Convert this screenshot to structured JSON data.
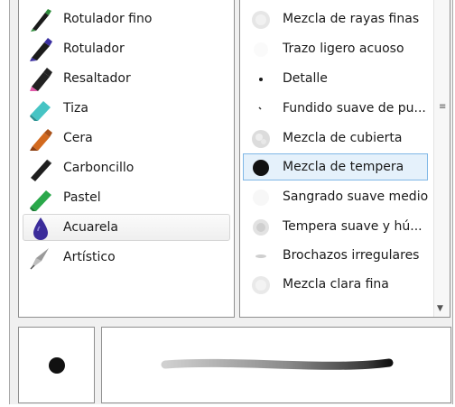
{
  "tools": [
    {
      "label": "Rotulador fino",
      "icon": "fine-marker-icon",
      "color": "#2e8b3a"
    },
    {
      "label": "Rotulador",
      "icon": "marker-icon",
      "color": "#3a2fa0"
    },
    {
      "label": "Resaltador",
      "icon": "highlighter-icon",
      "color": "#d63c9a"
    },
    {
      "label": "Tiza",
      "icon": "chalk-icon",
      "color": "#3cb4b4"
    },
    {
      "label": "Cera",
      "icon": "crayon-icon",
      "color": "#d2691e"
    },
    {
      "label": "Carboncillo",
      "icon": "charcoal-icon",
      "color": "#222222"
    },
    {
      "label": "Pastel",
      "icon": "pastel-icon",
      "color": "#2aa84a"
    },
    {
      "label": "Acuarela",
      "icon": "watercolor-icon",
      "color": "#5a3fb0",
      "selected": true
    },
    {
      "label": "Artístico",
      "icon": "artistic-pen-icon",
      "color": "#8a8a8a"
    }
  ],
  "presets": [
    {
      "label": "Mezcla de rayas finas",
      "icon": "fine-stripes-blend-icon"
    },
    {
      "label": "Trazo ligero acuoso",
      "icon": "light-watery-stroke-icon"
    },
    {
      "label": "Detalle",
      "icon": "detail-icon"
    },
    {
      "label": "Fundido suave de pu...",
      "icon": "soft-blend-icon"
    },
    {
      "label": "Mezcla de cubierta",
      "icon": "cover-blend-icon"
    },
    {
      "label": "Mezcla de tempera",
      "icon": "tempera-blend-icon",
      "selected": true
    },
    {
      "label": "Sangrado suave medio",
      "icon": "soft-bleed-icon"
    },
    {
      "label": "Tempera suave y hú...",
      "icon": "soft-wet-tempera-icon"
    },
    {
      "label": "Brochazos irregulares",
      "icon": "irregular-strokes-icon"
    },
    {
      "label": "Mezcla clara fina",
      "icon": "light-fine-blend-icon"
    }
  ],
  "colors": {
    "selection": "#e5f1fb",
    "selection_border": "#7fb7e6"
  }
}
